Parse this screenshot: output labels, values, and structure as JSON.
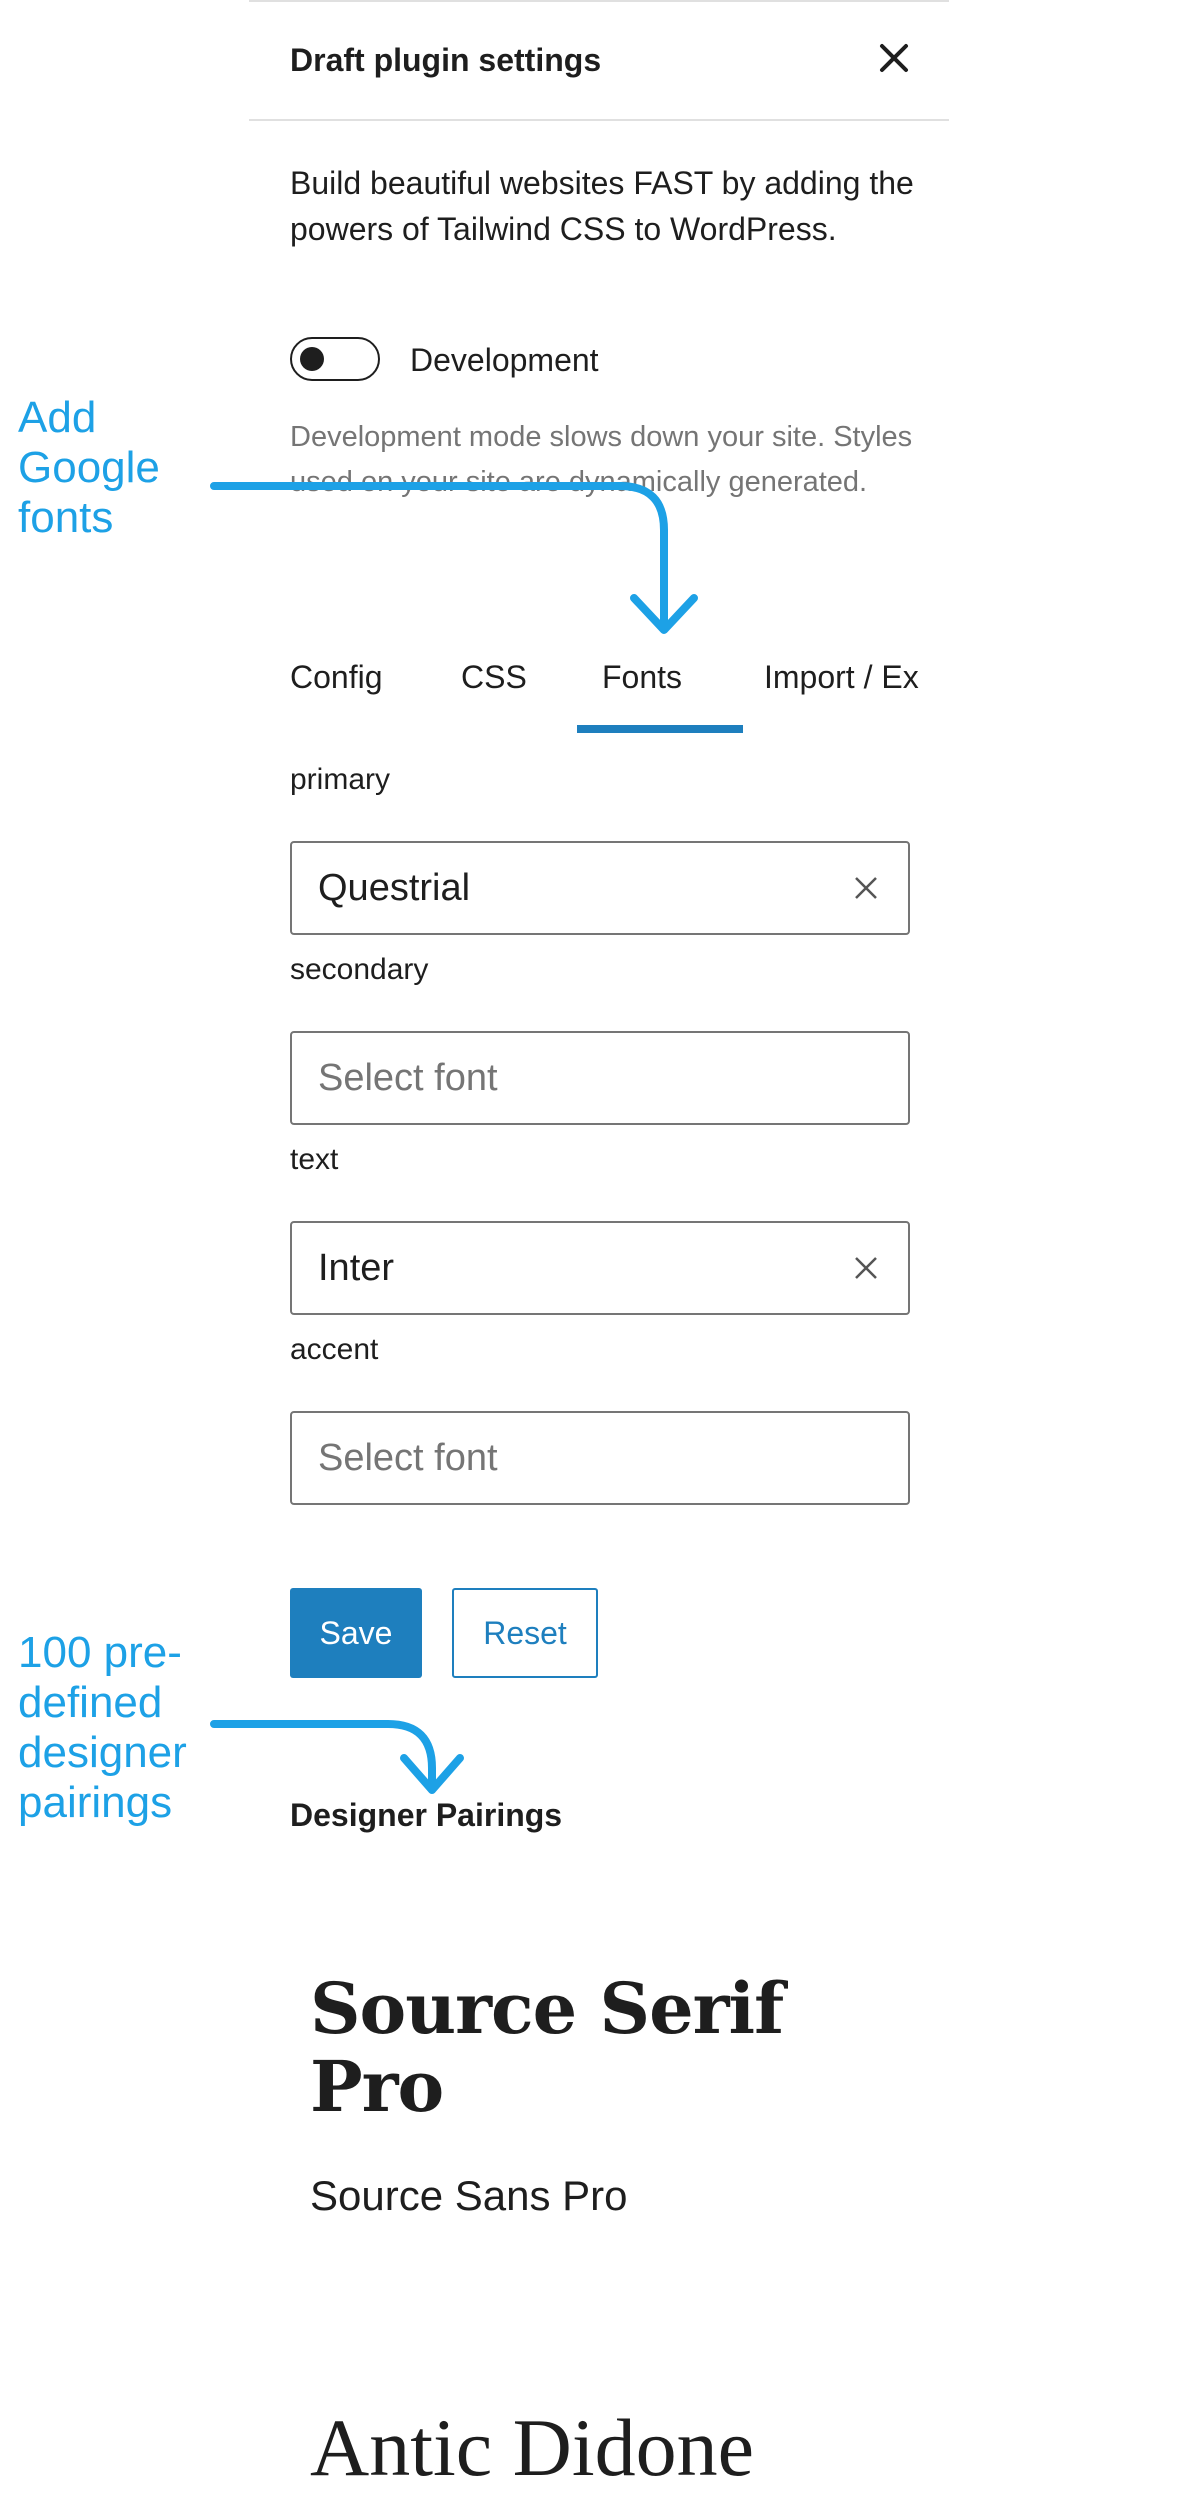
{
  "panel": {
    "title": "Draft plugin settings",
    "close_icon": "close-icon",
    "description": "Build beautiful websites FAST by adding the powers of Tailwind CSS to WordPress."
  },
  "development": {
    "toggle_label": "Development",
    "enabled": false,
    "help_text": "Development mode slows down your site. Styles used on your site are dynamically generated."
  },
  "tabs": [
    {
      "label": "Config",
      "active": false
    },
    {
      "label": "CSS",
      "active": false
    },
    {
      "label": "Fonts",
      "active": true
    },
    {
      "label": "Import / Ex",
      "active": false
    }
  ],
  "fonts": {
    "primary": {
      "label": "primary",
      "value": "Questrial",
      "placeholder": "Select font"
    },
    "secondary": {
      "label": "secondary",
      "value": "",
      "placeholder": "Select font"
    },
    "text": {
      "label": "text",
      "value": "Inter",
      "placeholder": "Select font"
    },
    "accent": {
      "label": "accent",
      "value": "",
      "placeholder": "Select font"
    }
  },
  "actions": {
    "save_label": "Save",
    "reset_label": "Reset"
  },
  "pairings": {
    "title": "Designer Pairings",
    "items": [
      {
        "heading": "Source Serif Pro",
        "body": "Source Sans Pro"
      },
      {
        "heading": "Antic Didone",
        "body": ""
      }
    ]
  },
  "annotations": {
    "google_fonts": [
      "Add",
      "Google",
      "fonts"
    ],
    "pairings": [
      "100 pre-",
      "defined",
      "designer",
      "pairings"
    ]
  },
  "colors": {
    "accent": "#1e7fbe",
    "annotation": "#1da1e6",
    "text": "#1e1e1e",
    "muted": "#757575"
  }
}
